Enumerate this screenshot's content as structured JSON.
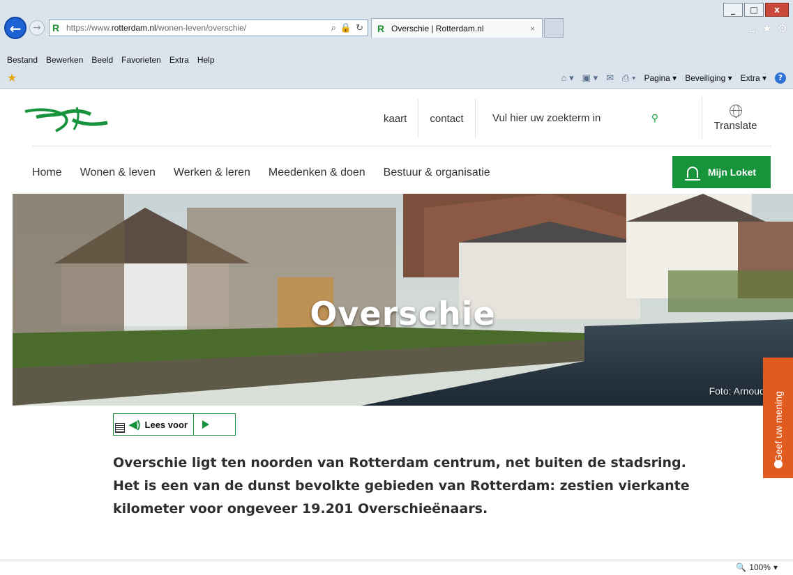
{
  "browser": {
    "address": {
      "prefix": "https://www.",
      "domain": "rotterdam.nl",
      "path": "/wonen-leven/overschie/"
    },
    "tab_title": "Overschie | Rotterdam.nl",
    "tab_close": "×",
    "window_buttons": {
      "minimize": "_",
      "maximize": "□",
      "close": "x"
    },
    "menu": [
      "Bestand",
      "Bewerken",
      "Beeld",
      "Favorieten",
      "Extra",
      "Help"
    ],
    "commands": {
      "pagina": "Pagina ▾",
      "beveiliging": "Beveiliging ▾",
      "extra": "Extra ▾"
    },
    "zoom": "100%"
  },
  "header": {
    "links": {
      "kaart": "kaart",
      "contact": "contact"
    },
    "search_placeholder": "Vul hier uw zoekterm in",
    "translate": "Translate",
    "nav": [
      "Home",
      "Wonen & leven",
      "Werken & leren",
      "Meedenken & doen",
      "Bestuur & organisatie"
    ],
    "loket": "Mijn Loket"
  },
  "hero": {
    "title": "Overschie",
    "credit": "Foto: Arnoud Ve"
  },
  "feedback": "Geef uw mening",
  "readspeaker": {
    "label": "Lees voor"
  },
  "intro": "Overschie ligt ten noorden van Rotterdam centrum, net buiten de stadsring. Het is een van de dunst bevolkte gebieden van Rotterdam: zestien vierkante kilometer voor ongeveer 19.201 Overschieënaars.",
  "colors": {
    "accent": "#17933b",
    "feedback": "#e15a1e",
    "chrome": "#dbe3ec"
  }
}
